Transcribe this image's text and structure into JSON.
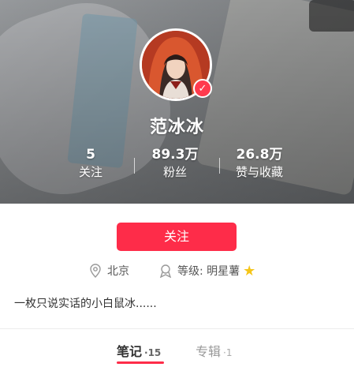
{
  "profile": {
    "name": "范冰冰",
    "stats": [
      {
        "value": "5",
        "label": "关注"
      },
      {
        "value": "89.3万",
        "label": "粉丝"
      },
      {
        "value": "26.8万",
        "label": "赞与收藏"
      }
    ],
    "follow_label": "关注",
    "location": "北京",
    "level": "等级: 明星薯",
    "bio": "一枚只说实话的小白鼠冰......"
  },
  "tabs": [
    {
      "label": "笔记",
      "count": "·15"
    },
    {
      "label": "专辑",
      "count": "·1"
    }
  ],
  "icons": {
    "verified": "verified-badge-icon",
    "location": "location-pin-icon",
    "level": "level-icon",
    "star": "star-icon"
  },
  "colors": {
    "accent": "#fe2c49",
    "star": "#f5c518"
  }
}
